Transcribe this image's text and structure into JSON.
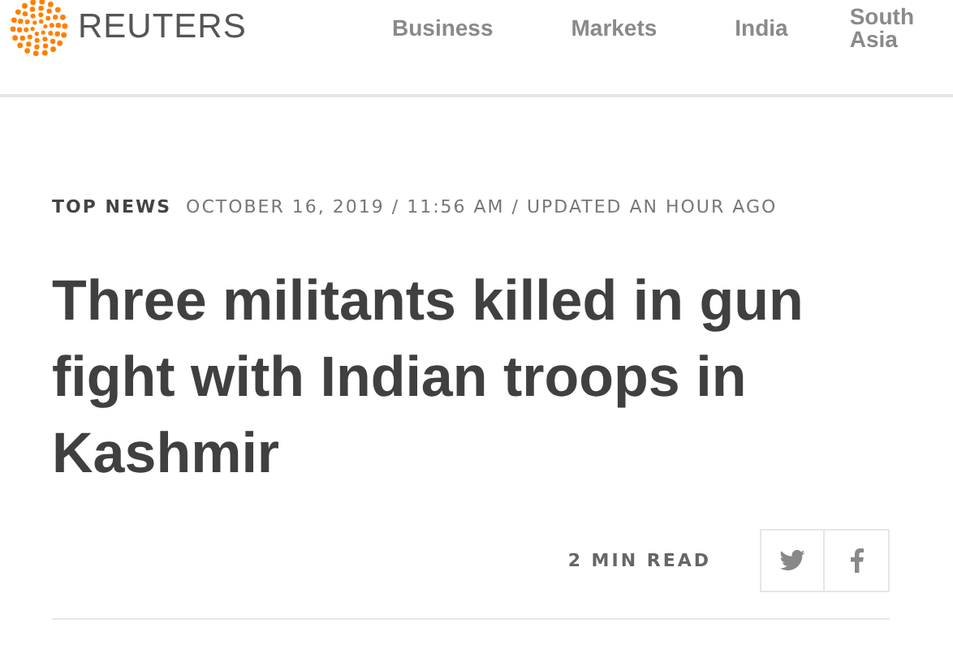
{
  "header": {
    "brand": "REUTERS",
    "nav": [
      {
        "label": "Business"
      },
      {
        "label": "Markets"
      },
      {
        "label": "India"
      },
      {
        "label": "South Asia"
      }
    ]
  },
  "article": {
    "section": "TOP NEWS",
    "dateline": "OCTOBER 16, 2019 / 11:56 AM / UPDATED AN HOUR AGO",
    "headline": "Three militants killed in gun fight with Indian troops in Kashmir",
    "read_time": "2 MIN READ",
    "share": [
      {
        "kind": "twitter"
      },
      {
        "kind": "facebook"
      }
    ]
  }
}
